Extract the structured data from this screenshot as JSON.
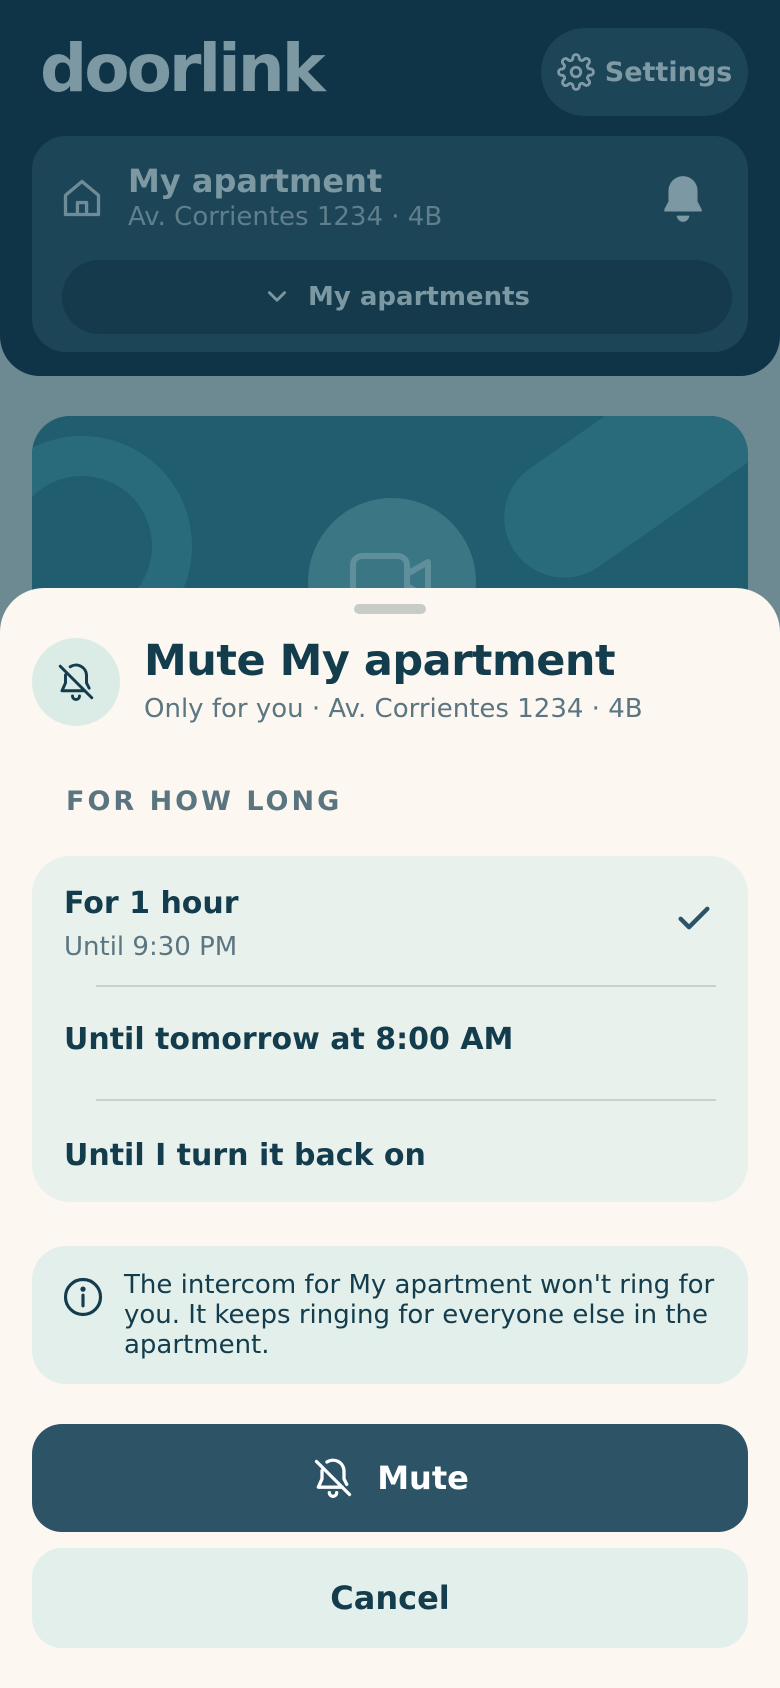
{
  "app": {
    "logo": "doorlink",
    "settings_label": "Settings",
    "apartment": {
      "name": "My apartment",
      "address": "Av. Corrientes 1234 · 4B"
    },
    "apartments_button": "My apartments"
  },
  "sheet": {
    "title": "Mute My apartment",
    "subtitle": "Only for you · Av. Corrientes 1234 · 4B",
    "section_label": "FOR HOW LONG",
    "options": [
      {
        "label": "For 1 hour",
        "sub": "Until 9:30 PM",
        "selected": true
      },
      {
        "label": "Until tomorrow at 8:00 AM",
        "sub": "",
        "selected": false
      },
      {
        "label": "Until I turn it back on",
        "sub": "",
        "selected": false
      }
    ],
    "info_text": "The intercom for My apartment won't ring for you. It keeps ringing for everyone else in the apartment.",
    "mute_label": "Mute",
    "cancel_label": "Cancel"
  },
  "colors": {
    "header_bg": "#0f3447",
    "sheet_bg": "#fcf8f1",
    "primary": "#2c5466",
    "text_dark": "#133c4d",
    "surface_mint": "#e8f1ec"
  }
}
